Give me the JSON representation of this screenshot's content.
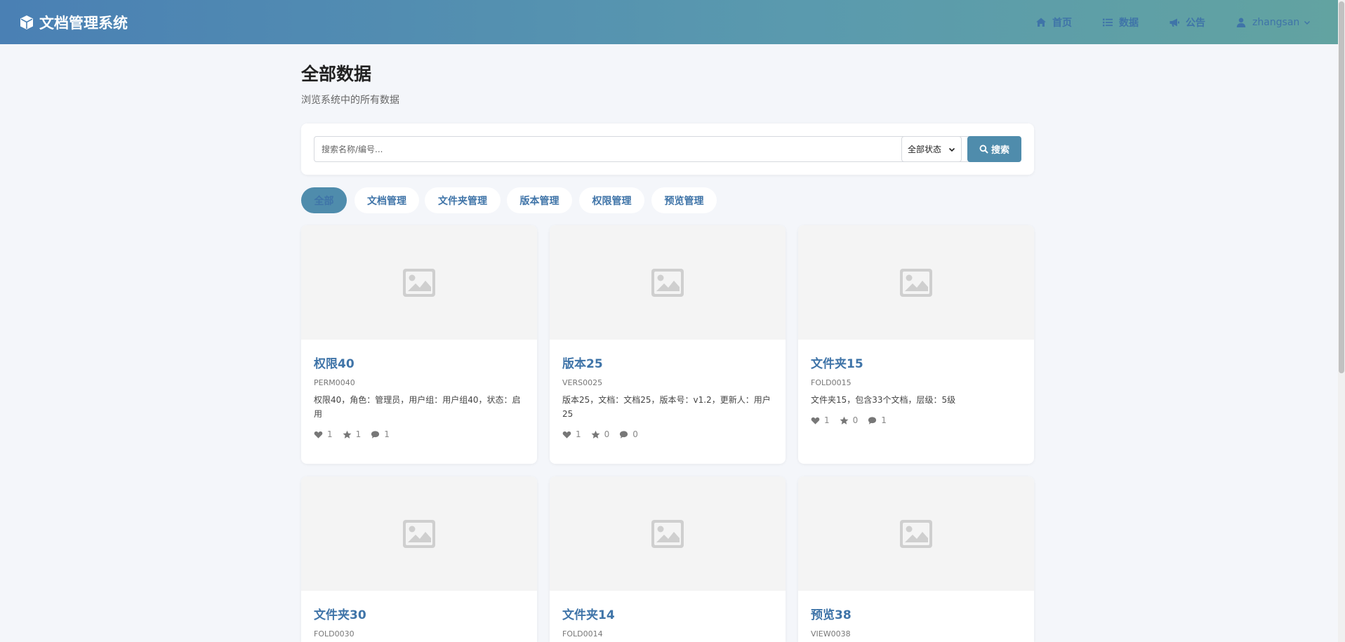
{
  "header": {
    "brand": "文档管理系统",
    "nav": {
      "home": "首页",
      "data": "数据",
      "notice": "公告",
      "user": "zhangsan"
    }
  },
  "page": {
    "title": "全部数据",
    "subtitle": "浏览系统中的所有数据"
  },
  "search": {
    "placeholder": "搜索名称/编号...",
    "status_selected": "全部状态",
    "button": "搜索"
  },
  "tabs": [
    {
      "label": "全部",
      "active": true
    },
    {
      "label": "文档管理"
    },
    {
      "label": "文件夹管理"
    },
    {
      "label": "版本管理"
    },
    {
      "label": "权限管理"
    },
    {
      "label": "预览管理"
    }
  ],
  "cards": [
    {
      "title": "权限40",
      "code": "PERM0040",
      "desc": "权限40，角色：管理员，用户组：用户组40，状态：启用",
      "likes": "1",
      "stars": "1",
      "comments": "1"
    },
    {
      "title": "版本25",
      "code": "VERS0025",
      "desc": "版本25，文档：文档25，版本号：v1.2，更新人：用户25",
      "likes": "1",
      "stars": "0",
      "comments": "0"
    },
    {
      "title": "文件夹15",
      "code": "FOLD0015",
      "desc": "文件夹15，包含33个文档，层级：5级",
      "likes": "1",
      "stars": "0",
      "comments": "1"
    },
    {
      "title": "文件夹30",
      "code": "FOLD0030"
    },
    {
      "title": "文件夹14",
      "code": "FOLD0014"
    },
    {
      "title": "预览38",
      "code": "VIEW0038"
    }
  ],
  "colors": {
    "accent": "#4f8cac",
    "link": "#3f74a8",
    "background": "#f4f6fa"
  },
  "icons": {
    "brand": "cube-icon",
    "home": "home-icon",
    "data": "list-icon",
    "notice": "megaphone-icon",
    "user": "user-icon",
    "placeholder": "image-icon",
    "like": "heart-icon",
    "star": "star-icon",
    "comment": "comment-icon"
  }
}
